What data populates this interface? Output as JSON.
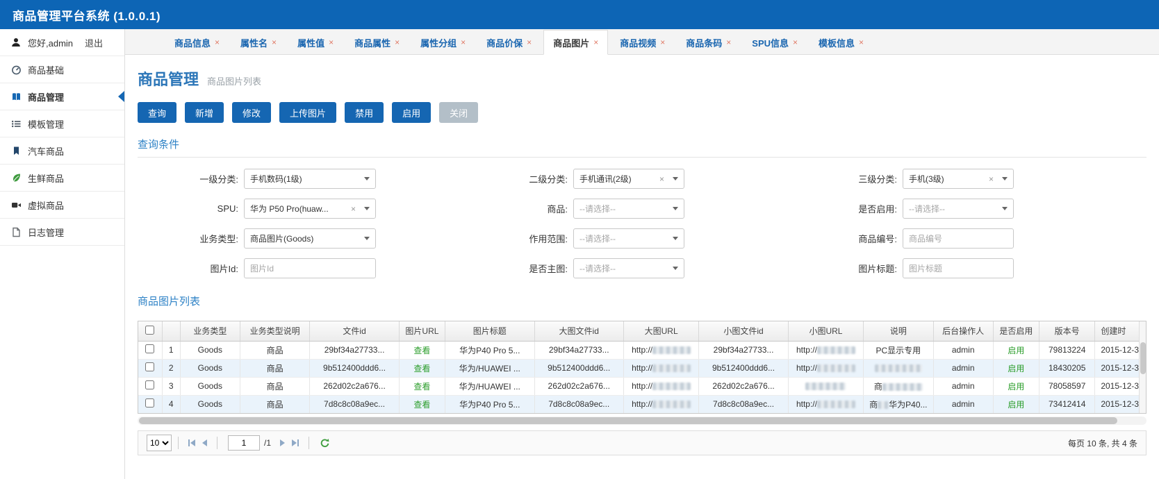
{
  "app": {
    "title": "商品管理平台系统 (1.0.0.1)"
  },
  "ui": {
    "tab_close_glyph": "×",
    "clear_glyph": "×"
  },
  "sidebar": {
    "user": {
      "greeting": "您好,admin",
      "logout": "退出"
    },
    "items": [
      {
        "label": "商品基础"
      },
      {
        "label": "商品管理"
      },
      {
        "label": "模板管理"
      },
      {
        "label": "汽车商品"
      },
      {
        "label": "生鲜商品"
      },
      {
        "label": "虚拟商品"
      },
      {
        "label": "日志管理"
      }
    ]
  },
  "tabs": [
    {
      "label": "商品信息"
    },
    {
      "label": "属性名"
    },
    {
      "label": "属性值"
    },
    {
      "label": "商品属性"
    },
    {
      "label": "属性分组"
    },
    {
      "label": "商品价保"
    },
    {
      "label": "商品图片"
    },
    {
      "label": "商品视频"
    },
    {
      "label": "商品条码"
    },
    {
      "label": "SPU信息"
    },
    {
      "label": "模板信息"
    }
  ],
  "page": {
    "title": "商品管理",
    "subtitle": "商品图片列表"
  },
  "toolbar": {
    "buttons": [
      {
        "label": "查询"
      },
      {
        "label": "新增"
      },
      {
        "label": "修改"
      },
      {
        "label": "上传图片"
      },
      {
        "label": "禁用"
      },
      {
        "label": "启用"
      },
      {
        "label": "关闭"
      }
    ]
  },
  "query": {
    "section_title": "查询条件",
    "fields": [
      {
        "label": "一级分类:",
        "value": "手机数码(1级)"
      },
      {
        "label": "二级分类:",
        "value": "手机通讯(2级)"
      },
      {
        "label": "三级分类:",
        "value": "手机(3级)"
      },
      {
        "label": "SPU:",
        "value": "华为 P50 Pro(huaw..."
      },
      {
        "label": "商品:",
        "placeholder": "--请选择--"
      },
      {
        "label": "是否启用:",
        "placeholder": "--请选择--"
      },
      {
        "label": "业务类型:",
        "value": "商品图片(Goods)"
      },
      {
        "label": "作用范围:",
        "placeholder": "--请选择--"
      },
      {
        "label": "商品编号:",
        "placeholder": "商品编号"
      },
      {
        "label": "图片Id:",
        "placeholder": "图片Id"
      },
      {
        "label": "是否主图:",
        "placeholder": "--请选择--"
      },
      {
        "label": "图片标题:",
        "placeholder": "图片标题"
      }
    ]
  },
  "list": {
    "section_title": "商品图片列表",
    "columns": [
      "业务类型",
      "业务类型说明",
      "文件id",
      "图片URL",
      "图片标题",
      "大图文件id",
      "大图URL",
      "小图文件id",
      "小图URL",
      "说明",
      "后台操作人",
      "是否启用",
      "版本号",
      "创建时"
    ],
    "rows": [
      {
        "num": "1",
        "biz_type": "Goods",
        "biz_desc": "商品",
        "file_id": "29bf34a27733...",
        "view": "查看",
        "title": "华为P40 Pro 5...",
        "big_id": "29bf34a27733...",
        "big_url": "http://",
        "small_id": "29bf34a27733...",
        "small_url": "http://",
        "desc_a": "PC显示专用",
        "desc_b": "",
        "operator": "admin",
        "status": "启用",
        "version": "79813224",
        "created": "2015-12-3"
      },
      {
        "num": "2",
        "biz_type": "Goods",
        "biz_desc": "商品",
        "file_id": "9b512400ddd6...",
        "view": "查看",
        "title": "华为/HUAWEI ...",
        "big_id": "9b512400ddd6...",
        "big_url": "http://",
        "small_id": "9b512400ddd6...",
        "small_url": "http://",
        "desc_a": "",
        "desc_b": "",
        "operator": "admin",
        "status": "启用",
        "version": "18430205",
        "created": "2015-12-3"
      },
      {
        "num": "3",
        "biz_type": "Goods",
        "biz_desc": "商品",
        "file_id": "262d02c2a676...",
        "view": "查看",
        "title": "华为/HUAWEI ...",
        "big_id": "262d02c2a676...",
        "big_url": "http://",
        "small_id": "262d02c2a676...",
        "small_url": "http://",
        "desc_a": "商",
        "desc_b": "",
        "operator": "admin",
        "status": "启用",
        "version": "78058597",
        "created": "2015-12-3"
      },
      {
        "num": "4",
        "biz_type": "Goods",
        "biz_desc": "商品",
        "file_id": "7d8c8c08a9ec...",
        "view": "查看",
        "title": "华为P40 Pro 5...",
        "big_id": "7d8c8c08a9ec...",
        "big_url": "http://",
        "small_id": "7d8c8c08a9ec...",
        "small_url": "http://",
        "desc_a": "商",
        "desc_b": "华为P40...",
        "operator": "admin",
        "status": "启用",
        "version": "73412414",
        "created": "2015-12-3"
      }
    ]
  },
  "pagination": {
    "page_size": "10",
    "current_page": "1",
    "page_count_label": "/1",
    "summary": "每页 10 条, 共 4 条"
  }
}
